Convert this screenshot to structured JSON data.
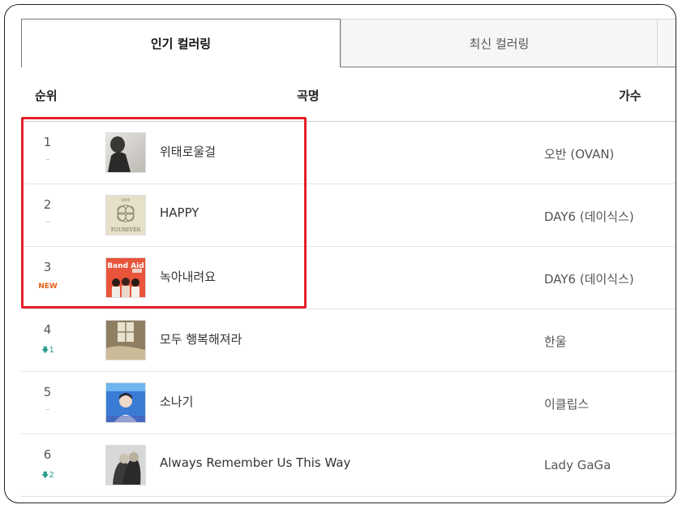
{
  "tabs": [
    {
      "label": "인기 컬러링",
      "active": true
    },
    {
      "label": "최신 컬러링",
      "active": false
    }
  ],
  "headers": {
    "rank": "순위",
    "song": "곡명",
    "artist": "가수"
  },
  "colors": {
    "new_badge": "#e8611a",
    "down_arrow": "#2a9d8f",
    "highlight_border": "#e4202b"
  },
  "rows": [
    {
      "rank": "1",
      "change": "–",
      "title": "위태로울걸",
      "artist": "오반 (OVAN)"
    },
    {
      "rank": "2",
      "change": "–",
      "title": "HAPPY",
      "artist": "DAY6 (데이식스)"
    },
    {
      "rank": "3",
      "change": "NEW",
      "title": "녹아내려요",
      "artist": "DAY6 (데이식스)"
    },
    {
      "rank": "4",
      "change": "1",
      "change_dir": "down",
      "title": "모두 행복해져라",
      "artist": "한울"
    },
    {
      "rank": "5",
      "change": "–",
      "title": "소나기",
      "artist": "이클립스"
    },
    {
      "rank": "6",
      "change": "2",
      "change_dir": "down",
      "title": "Always Remember Us This Way",
      "artist": "Lady GaGa"
    }
  ],
  "album_labels": {
    "row2_top": "DAY6",
    "row2_bottom": "FOUREVER",
    "row3": "Band Aid"
  }
}
